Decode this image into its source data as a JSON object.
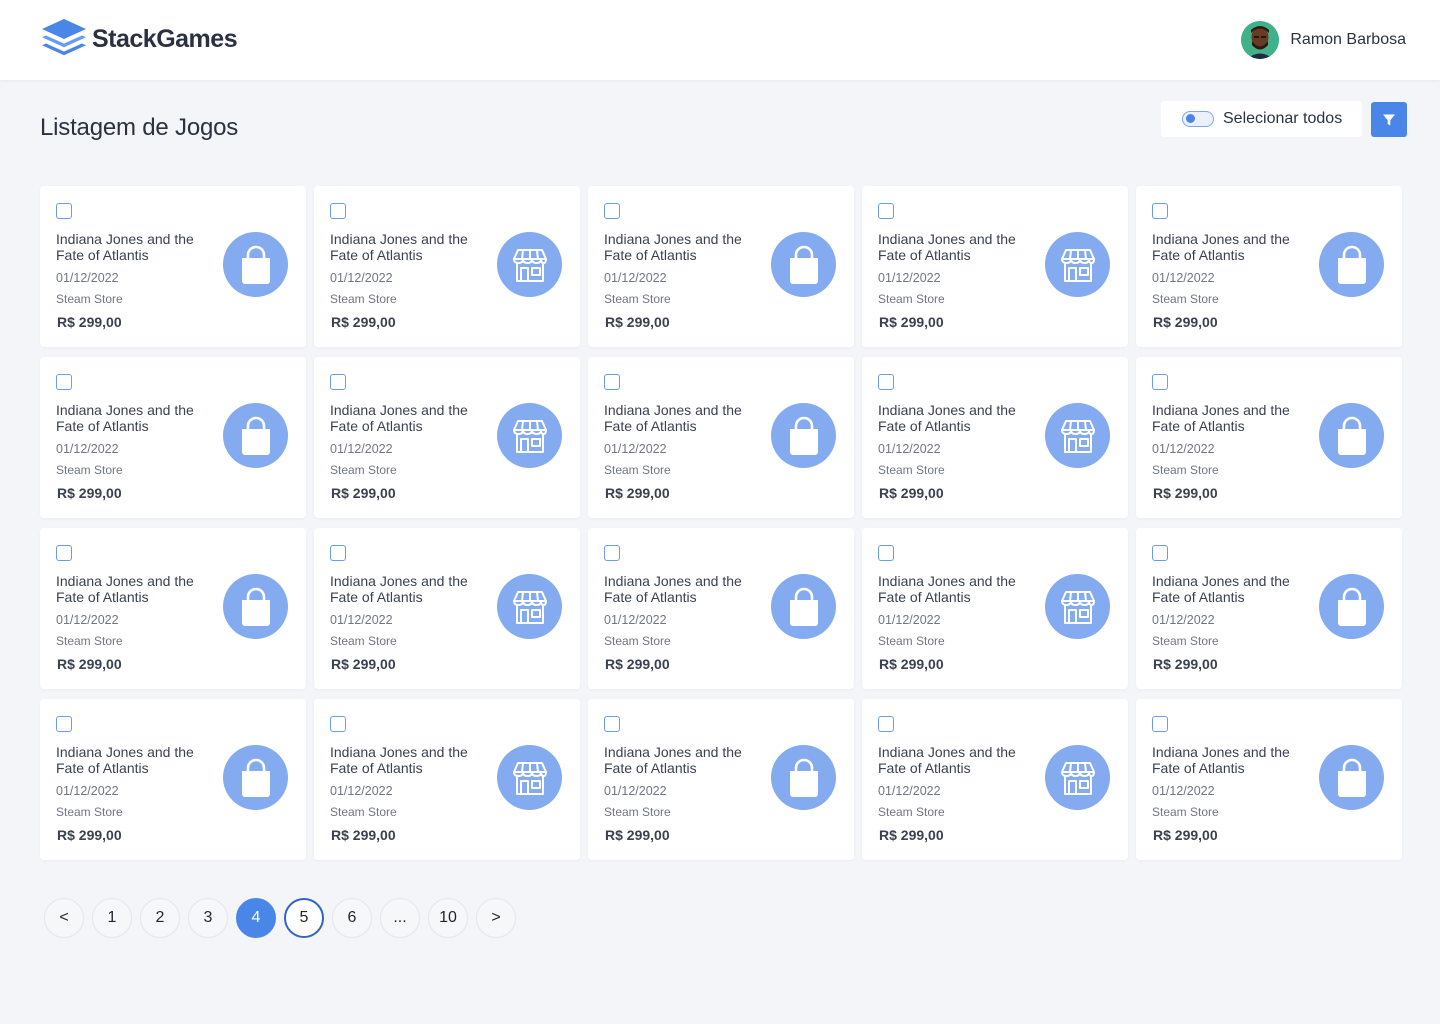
{
  "app": {
    "name": "StackGames"
  },
  "user": {
    "name": "Ramon Barbosa"
  },
  "page": {
    "title": "Listagem de Jogos"
  },
  "toolbar": {
    "select_all_label": "Selecionar todos",
    "filter_icon": "filter-icon"
  },
  "colors": {
    "accent": "#4a86e8",
    "icon_bg": "#84aaf0",
    "background": "#f3f5f9"
  },
  "games": [
    {
      "title": "Indiana Jones and the Fate of Atlantis",
      "date": "01/12/2022",
      "store": "Steam Store",
      "price": "R$ 299,00",
      "icon": "shopping-bag-icon"
    },
    {
      "title": "Indiana Jones and the Fate of Atlantis",
      "date": "01/12/2022",
      "store": "Steam Store",
      "price": "R$ 299,00",
      "icon": "storefront-icon"
    },
    {
      "title": "Indiana Jones and the Fate of Atlantis",
      "date": "01/12/2022",
      "store": "Steam Store",
      "price": "R$ 299,00",
      "icon": "shopping-bag-icon"
    },
    {
      "title": "Indiana Jones and the Fate of Atlantis",
      "date": "01/12/2022",
      "store": "Steam Store",
      "price": "R$ 299,00",
      "icon": "storefront-icon"
    },
    {
      "title": "Indiana Jones and the Fate of Atlantis",
      "date": "01/12/2022",
      "store": "Steam Store",
      "price": "R$ 299,00",
      "icon": "shopping-bag-icon"
    },
    {
      "title": "Indiana Jones and the Fate of Atlantis",
      "date": "01/12/2022",
      "store": "Steam Store",
      "price": "R$ 299,00",
      "icon": "shopping-bag-icon"
    },
    {
      "title": "Indiana Jones and the Fate of Atlantis",
      "date": "01/12/2022",
      "store": "Steam Store",
      "price": "R$ 299,00",
      "icon": "storefront-icon"
    },
    {
      "title": "Indiana Jones and the Fate of Atlantis",
      "date": "01/12/2022",
      "store": "Steam Store",
      "price": "R$ 299,00",
      "icon": "shopping-bag-icon"
    },
    {
      "title": "Indiana Jones and the Fate of Atlantis",
      "date": "01/12/2022",
      "store": "Steam Store",
      "price": "R$ 299,00",
      "icon": "storefront-icon"
    },
    {
      "title": "Indiana Jones and the Fate of Atlantis",
      "date": "01/12/2022",
      "store": "Steam Store",
      "price": "R$ 299,00",
      "icon": "shopping-bag-icon"
    },
    {
      "title": "Indiana Jones and the Fate of Atlantis",
      "date": "01/12/2022",
      "store": "Steam Store",
      "price": "R$ 299,00",
      "icon": "shopping-bag-icon"
    },
    {
      "title": "Indiana Jones and the Fate of Atlantis",
      "date": "01/12/2022",
      "store": "Steam Store",
      "price": "R$ 299,00",
      "icon": "storefront-icon"
    },
    {
      "title": "Indiana Jones and the Fate of Atlantis",
      "date": "01/12/2022",
      "store": "Steam Store",
      "price": "R$ 299,00",
      "icon": "shopping-bag-icon"
    },
    {
      "title": "Indiana Jones and the Fate of Atlantis",
      "date": "01/12/2022",
      "store": "Steam Store",
      "price": "R$ 299,00",
      "icon": "storefront-icon"
    },
    {
      "title": "Indiana Jones and the Fate of Atlantis",
      "date": "01/12/2022",
      "store": "Steam Store",
      "price": "R$ 299,00",
      "icon": "shopping-bag-icon"
    },
    {
      "title": "Indiana Jones and the Fate of Atlantis",
      "date": "01/12/2022",
      "store": "Steam Store",
      "price": "R$ 299,00",
      "icon": "shopping-bag-icon"
    },
    {
      "title": "Indiana Jones and the Fate of Atlantis",
      "date": "01/12/2022",
      "store": "Steam Store",
      "price": "R$ 299,00",
      "icon": "storefront-icon"
    },
    {
      "title": "Indiana Jones and the Fate of Atlantis",
      "date": "01/12/2022",
      "store": "Steam Store",
      "price": "R$ 299,00",
      "icon": "shopping-bag-icon"
    },
    {
      "title": "Indiana Jones and the Fate of Atlantis",
      "date": "01/12/2022",
      "store": "Steam Store",
      "price": "R$ 299,00",
      "icon": "storefront-icon"
    },
    {
      "title": "Indiana Jones and the Fate of Atlantis",
      "date": "01/12/2022",
      "store": "Steam Store",
      "price": "R$ 299,00",
      "icon": "shopping-bag-icon"
    }
  ],
  "pagination": {
    "items": [
      {
        "label": "<",
        "kind": "prev"
      },
      {
        "label": "1",
        "kind": "page"
      },
      {
        "label": "2",
        "kind": "page"
      },
      {
        "label": "3",
        "kind": "page"
      },
      {
        "label": "4",
        "kind": "current"
      },
      {
        "label": "5",
        "kind": "highlight"
      },
      {
        "label": "6",
        "kind": "page"
      },
      {
        "label": "...",
        "kind": "ellipsis"
      },
      {
        "label": "10",
        "kind": "page"
      },
      {
        "label": ">",
        "kind": "next"
      }
    ]
  }
}
